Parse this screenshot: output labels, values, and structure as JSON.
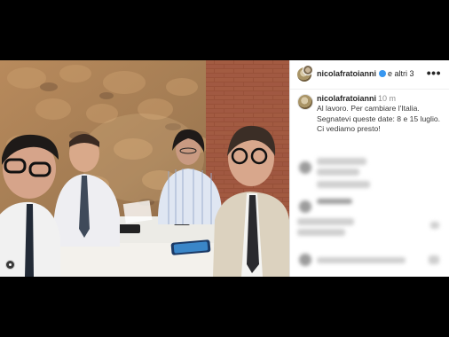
{
  "post": {
    "username": "nicolafratoianni",
    "others": "e altri 3",
    "more_icon": "•••"
  },
  "caption": {
    "username": "nicolafratoianni",
    "time": "10 m",
    "lines": [
      "Al lavoro. Per cambiare l'Italia.",
      "Segnatevi queste date: 8 e 15 luglio.",
      "Ci vediamo presto!"
    ]
  },
  "colors": {
    "verified": "#3897f0",
    "letterbox": "#000000"
  }
}
